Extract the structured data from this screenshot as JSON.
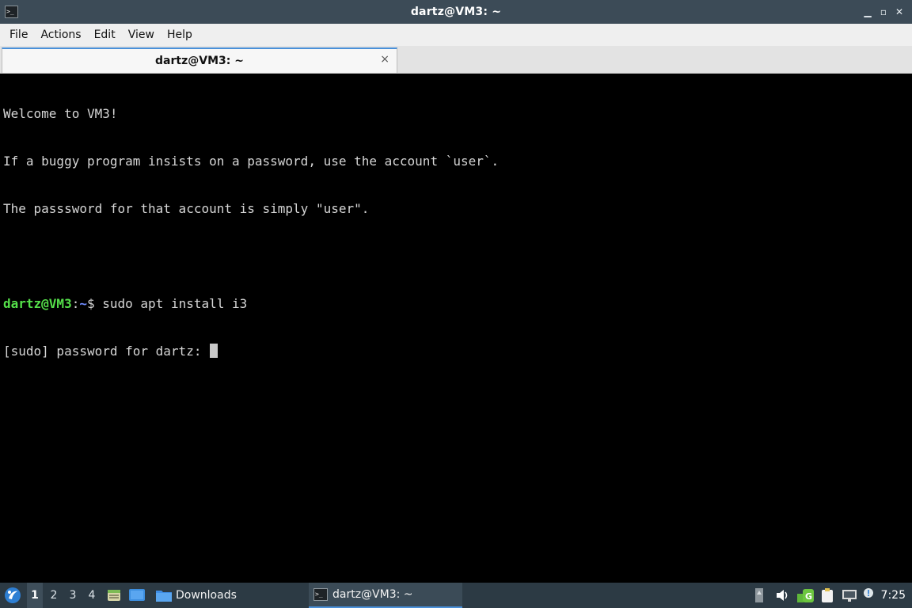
{
  "window": {
    "title": "dartz@VM3: ~",
    "icon": "terminal-icon",
    "buttons": [
      "minimize-icon",
      "maximize-icon",
      "close-icon"
    ]
  },
  "menu": {
    "items": [
      "File",
      "Actions",
      "Edit",
      "View",
      "Help"
    ]
  },
  "tabs": [
    {
      "label": "dartz@VM3: ~",
      "close": "×"
    }
  ],
  "terminal": {
    "lines": [
      "Welcome to VM3!",
      "If a buggy program insists on a password, use the account `user`.",
      "The passsword for that account is simply \"user\".",
      ""
    ],
    "prompt": {
      "user_host": "dartz@VM3",
      "colon": ":",
      "path": "~",
      "symbol": "$",
      "command": " sudo apt install i3"
    },
    "sudo_line": "[sudo] password for dartz: "
  },
  "taskbar": {
    "start_icon": "lxqt-menu-icon",
    "desktops": [
      "1",
      "2",
      "3",
      "4"
    ],
    "active_desktop": "1",
    "quicklaunch": [
      "file-manager-icon",
      "show-desktop-icon"
    ],
    "tasks": [
      {
        "label": "Downloads",
        "icon": "folder-icon"
      },
      {
        "label": "dartz@VM3: ~",
        "icon": "terminal-icon"
      }
    ],
    "tray": [
      "scroll-indicator-icon",
      "volume-icon",
      "network-update-icon",
      "clipboard-icon",
      "network-icon",
      "notification-icon"
    ],
    "clock": "7:25"
  },
  "colors": {
    "titlebar": "#3c4b57",
    "taskbar": "#2c3a44",
    "prompt_user": "#55e04a",
    "prompt_path": "#6f8cff",
    "accent": "#4a90d9"
  }
}
